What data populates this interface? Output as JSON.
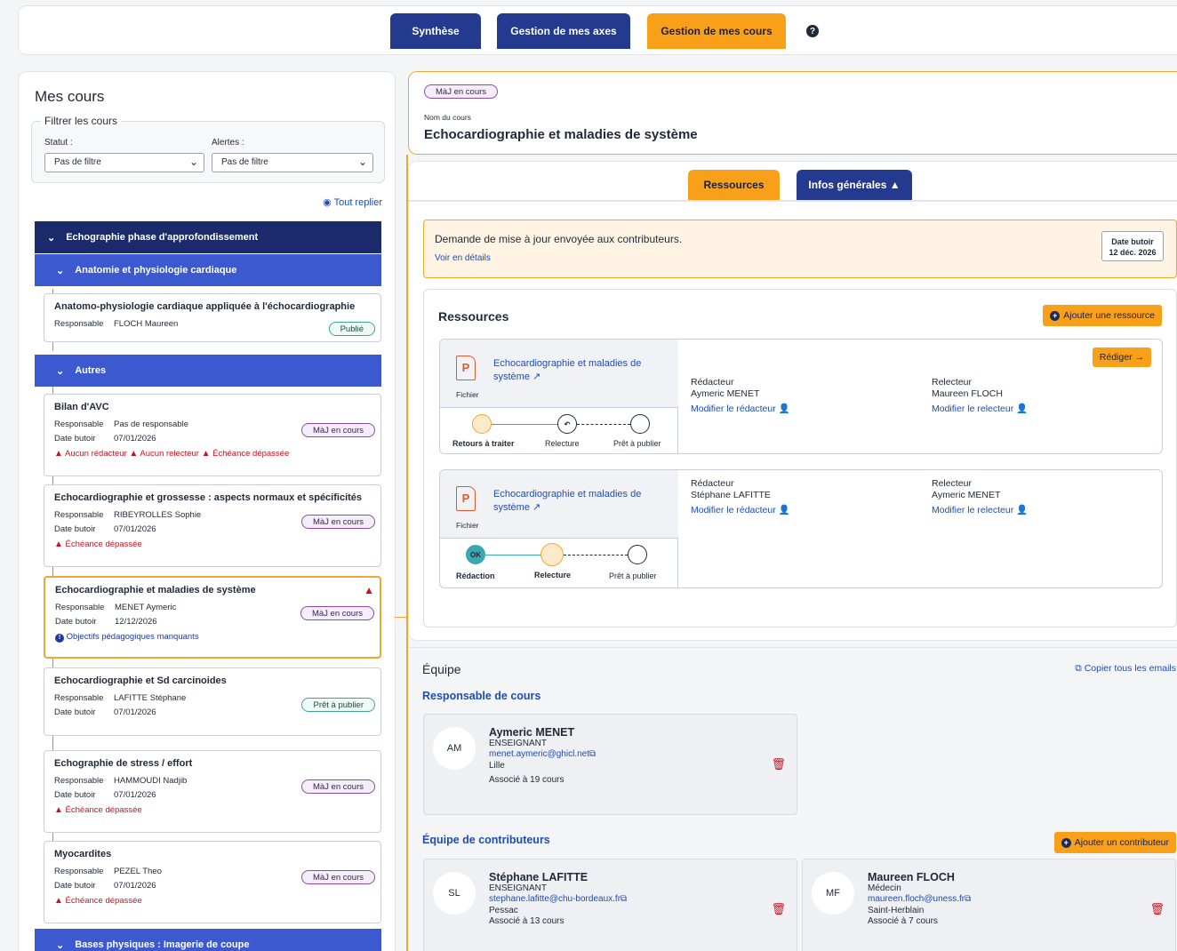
{
  "nav": {
    "tabs": [
      "Synthèse",
      "Gestion de mes axes",
      "Gestion de mes cours"
    ],
    "help": "?"
  },
  "left": {
    "title": "Mes cours",
    "filter_legend": "Filtrer les cours",
    "statut_label": "Statut :",
    "statut_value": "Pas de filtre",
    "alertes_label": "Alertes :",
    "alertes_value": "Pas de filtre",
    "replier": "Tout replier",
    "groups": {
      "g1": "Echographie phase d'approfondissement",
      "g2": "Anatomie et physiologie cardiaque",
      "g3": "Autres",
      "g4": "Bases physiques : Imagerie de coupe"
    },
    "labels": {
      "resp": "Responsable",
      "date": "Date butoir"
    },
    "courses": [
      {
        "title": "Anatomo-physiologie cardiaque appliquée à l'échocardiographie",
        "resp": "FLOCH Maureen",
        "date": "",
        "badge": "Publié",
        "alerts": []
      },
      {
        "title": "Bilan d'AVC",
        "resp": "Pas de responsable",
        "date": "07/01/2026",
        "badge": "MàJ en cours",
        "alerts": [
          "Aucun rédacteur",
          "Aucun relecteur",
          "Échéance dépassée"
        ]
      },
      {
        "title": "Echocardiographie et grossesse : aspects normaux et spécificités",
        "resp": "RIBEYROLLES Sophie",
        "date": "07/01/2026",
        "badge": "MàJ en cours",
        "alerts": [
          "Échéance dépassée"
        ]
      },
      {
        "title": "Echocardiographie et maladies de système",
        "resp": "MENET Aymeric",
        "date": "12/12/2026",
        "badge": "MàJ en cours",
        "info": "Objectifs pédagogiques manquants"
      },
      {
        "title": "Echocardiographie et Sd carcinoides",
        "resp": "LAFITTE Stéphane",
        "date": "07/01/2026",
        "badge": "Prêt à publier",
        "alerts": []
      },
      {
        "title": "Echographie de stress / effort",
        "resp": "HAMMOUDI Nadjib",
        "date": "07/01/2026",
        "badge": "MàJ en cours",
        "alerts": [
          "Échéance dépassée"
        ]
      },
      {
        "title": "Myocardites",
        "resp": "PEZEL Theo",
        "date": "07/01/2026",
        "badge": "MàJ en cours",
        "alerts": [
          "Échéance dépassée"
        ]
      }
    ]
  },
  "header": {
    "status_badge": "MàJ en cours",
    "name_label": "Nom du cours",
    "name": "Echocardiographie et maladies de système"
  },
  "content": {
    "tabs": [
      "Ressources",
      "Infos générales"
    ],
    "notice": "Demande de mise à jour envoyée aux contributeurs.",
    "notice_link": "Voir en détails",
    "deadline_label": "Date butoir",
    "deadline_value": "12 déc. 2026",
    "res_title": "Ressources",
    "add_resource": "Ajouter une ressource",
    "resources": [
      {
        "title": "Echocardiographie et maladies de système",
        "type": "Fichier",
        "steps": [
          "Retours à traiter",
          "Relecture",
          "Prêt à publier"
        ],
        "redacteur_label": "Rédacteur",
        "redacteur": "Aymeric MENET",
        "mod_red": "Modifier le rédacteur",
        "relecteur_label": "Relecteur",
        "relecteur": "Maureen FLOCH",
        "mod_rel": "Modifier le relecteur",
        "action": "Rédiger →"
      },
      {
        "title": "Echocardiographie et maladies de système",
        "type": "Fichier",
        "steps": [
          "Rédaction",
          "Relecture",
          "Prêt à publier"
        ],
        "ok": "OK",
        "redacteur_label": "Rédacteur",
        "redacteur": "Stéphane LAFITTE",
        "mod_red": "Modifier le rédacteur",
        "relecteur_label": "Relecteur",
        "relecteur": "Aymeric MENET",
        "mod_rel": "Modifier le relecteur"
      }
    ]
  },
  "team": {
    "title": "Équipe",
    "copy": "Copier tous les emails",
    "resp_title": "Responsable de cours",
    "contrib_title": "Équipe de contributeurs",
    "add_contrib": "Ajouter un contributeur",
    "people": [
      {
        "initials": "AM",
        "name": "Aymeric MENET",
        "role": "ENSEIGNANT",
        "email": "menet.aymeric@ghicl.net",
        "city": "Lille",
        "courses": "Associé à 19 cours"
      },
      {
        "initials": "SL",
        "name": "Stéphane LAFITTE",
        "role": "ENSEIGNANT",
        "email": "stephane.lafitte@chu-bordeaux.fr",
        "city": "Pessac",
        "courses": "Associé à 13 cours"
      },
      {
        "initials": "MF",
        "name": "Maureen FLOCH",
        "role": "Médecin",
        "email": "maureen.floch@uness.fr",
        "city": "Saint-Herblain",
        "courses": "Associé à 7 cours"
      }
    ]
  }
}
